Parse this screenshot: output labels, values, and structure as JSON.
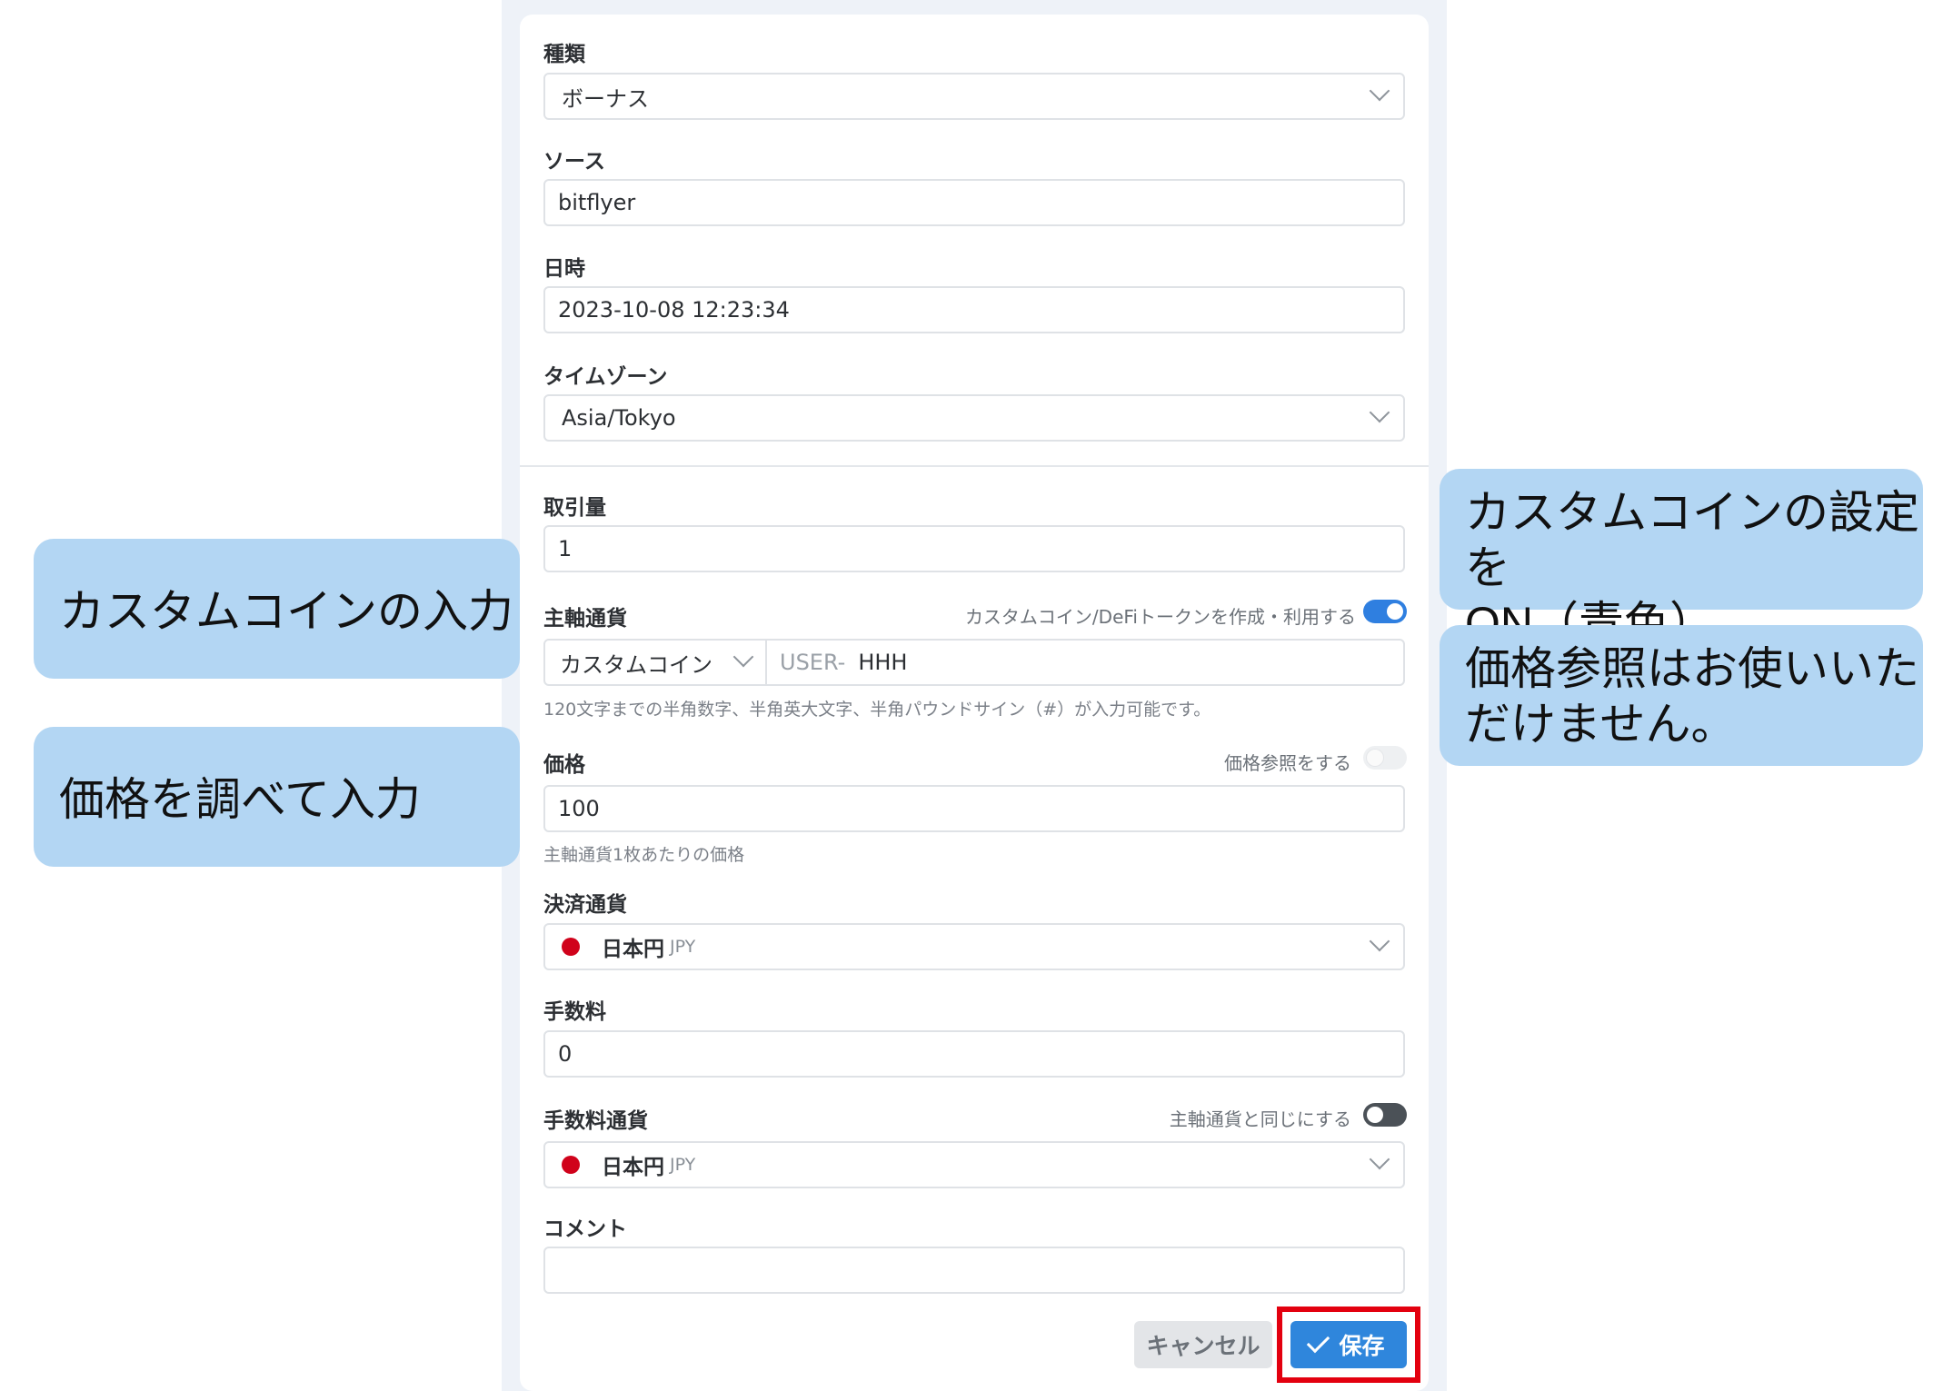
{
  "form": {
    "type": {
      "label": "種類",
      "value": "ボーナス"
    },
    "source": {
      "label": "ソース",
      "value": "bitflyer"
    },
    "datetime": {
      "label": "日時",
      "value": "2023-10-08 12:23:34"
    },
    "timezone": {
      "label": "タイムゾーン",
      "value": "Asia/Tokyo"
    },
    "amount": {
      "label": "取引量",
      "value": "1"
    },
    "main_currency": {
      "label": "主軸通貨",
      "toggle_label": "カスタムコイン/DeFiトークンを作成・利用する",
      "toggle_on": true,
      "select_value": "カスタムコイン",
      "prefix": "USER-",
      "value": "HHH",
      "helper": "120文字までの半角数字、半角英大文字、半角パウンドサイン（#）が入力可能です。"
    },
    "price": {
      "label": "価格",
      "toggle_label": "価格参照をする",
      "toggle_on": false,
      "value": "100",
      "helper": "主軸通貨1枚あたりの価格"
    },
    "settlement_currency": {
      "label": "決済通貨",
      "name": "日本円",
      "code": "JPY",
      "flag_color": "#d0021b"
    },
    "fee": {
      "label": "手数料",
      "value": "0"
    },
    "fee_currency": {
      "label": "手数料通貨",
      "toggle_label": "主軸通貨と同じにする",
      "toggle_on": false,
      "name": "日本円",
      "code": "JPY"
    },
    "comment": {
      "label": "コメント",
      "value": ""
    }
  },
  "buttons": {
    "cancel": "キャンセル",
    "save": "保存"
  },
  "callouts": {
    "custom_coin_input": "カスタムコインの入力",
    "price_input": "価格を調べて入力",
    "custom_coin_on_line1": "カスタムコインの設定を",
    "custom_coin_on_line2": "ON（青色）",
    "price_ref_line1": "価格参照はお使いいた",
    "price_ref_line2": "だけません。"
  },
  "colors": {
    "accent": "#2f86dc",
    "callout": "#b3d6f3",
    "highlight": "#e3000f"
  }
}
